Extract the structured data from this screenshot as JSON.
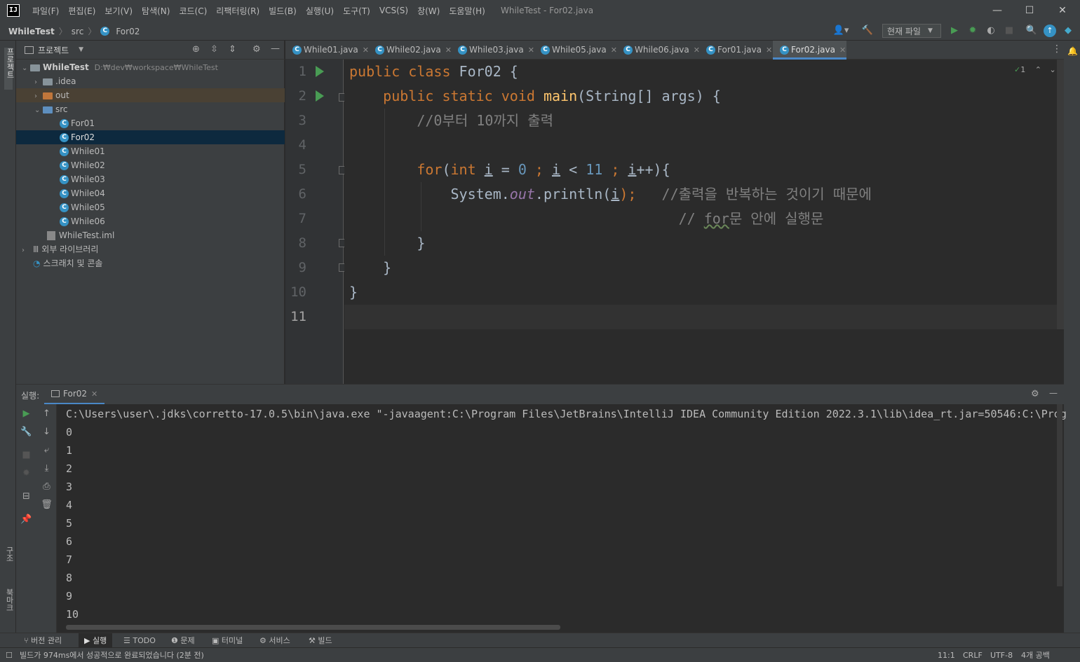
{
  "app": {
    "logo": "IJ",
    "window_title": "WhileTest - For02.java"
  },
  "menu": [
    "파일(F)",
    "편집(E)",
    "보기(V)",
    "탐색(N)",
    "코드(C)",
    "리팩터링(R)",
    "빌드(B)",
    "실행(U)",
    "도구(T)",
    "VCS(S)",
    "창(W)",
    "도움말(H)"
  ],
  "window_controls": {
    "minimize": "—",
    "maximize": "☐",
    "close": "✕"
  },
  "breadcrumb": [
    "WhileTest",
    "src",
    "For02"
  ],
  "toolbar": {
    "run_config": "현재 파일"
  },
  "left_strip": {
    "project": "프로젝트",
    "structure": "구조",
    "bookmarks": "북마크"
  },
  "project_panel": {
    "title": "프로젝트",
    "root": {
      "name": "WhileTest",
      "path": "D:₩dev₩workspace₩WhileTest"
    },
    "items": [
      {
        "label": ".idea"
      },
      {
        "label": "out"
      },
      {
        "label": "src"
      },
      {
        "label": "For01"
      },
      {
        "label": "For02"
      },
      {
        "label": "While01"
      },
      {
        "label": "While02"
      },
      {
        "label": "While03"
      },
      {
        "label": "While04"
      },
      {
        "label": "While05"
      },
      {
        "label": "While06"
      },
      {
        "label": "WhileTest.iml"
      },
      {
        "label": "외부 라이브러리"
      },
      {
        "label": "스크래치 및 콘솔"
      }
    ]
  },
  "tabs": [
    {
      "label": "While01.java"
    },
    {
      "label": "While02.java"
    },
    {
      "label": "While03.java"
    },
    {
      "label": "While05.java"
    },
    {
      "label": "While06.java"
    },
    {
      "label": "For01.java"
    },
    {
      "label": "For02.java"
    }
  ],
  "editor": {
    "inspection_count": "1",
    "line_numbers": [
      "1",
      "2",
      "3",
      "4",
      "5",
      "6",
      "7",
      "8",
      "9",
      "10",
      "11"
    ],
    "code": {
      "l1a": "public class ",
      "l1b": "For02 {",
      "l2a": "    public static void ",
      "l2b": "main",
      "l2c": "(String[] args) {",
      "l3": "        //0부터 10까지 출력",
      "l5a": "        for",
      "l5b": "(",
      "l5c": "int ",
      "l5d": "i",
      "l5e": " = ",
      "l5f": "0",
      "l5g": " ; ",
      "l5h": "i",
      "l5i": " < ",
      "l5j": "11",
      "l5k": " ; ",
      "l5l": "i",
      "l5m": "++){",
      "l6a": "            System.",
      "l6b": "out",
      "l6c": ".println(",
      "l6d": "i",
      "l6e": ");",
      "l6f": "   //출력을 반복하는 것이기 때문에",
      "l7a": "                                       // ",
      "l7b": "for",
      "l7c": "문 안에 실행문",
      "l8": "        }",
      "l9": "    }",
      "l10": "}"
    }
  },
  "run_panel": {
    "label": "실행:",
    "tab": "For02",
    "command": "C:\\Users\\user\\.jdks\\corretto-17.0.5\\bin\\java.exe \"-javaagent:C:\\Program Files\\JetBrains\\IntelliJ IDEA Community Edition 2022.3.1\\lib\\idea_rt.jar=50546:C:\\Prog",
    "output": [
      "0",
      "1",
      "2",
      "3",
      "4",
      "5",
      "6",
      "7",
      "8",
      "9",
      "10"
    ]
  },
  "bottom_tabs": [
    "버전 관리",
    "실행",
    "TODO",
    "문제",
    "터미널",
    "서비스",
    "빌드"
  ],
  "status": {
    "message": "빌드가 974ms에서 성공적으로 완료되었습니다 (2분 전)",
    "position": "11:1",
    "line_ending": "CRLF",
    "encoding": "UTF-8",
    "indent": "4개 공백"
  },
  "colors": {
    "accent": "#4a88c7",
    "run_green": "#499c54",
    "keyword": "#cc7832",
    "string": "#6a8759",
    "number": "#6897bb",
    "comment": "#808080"
  }
}
